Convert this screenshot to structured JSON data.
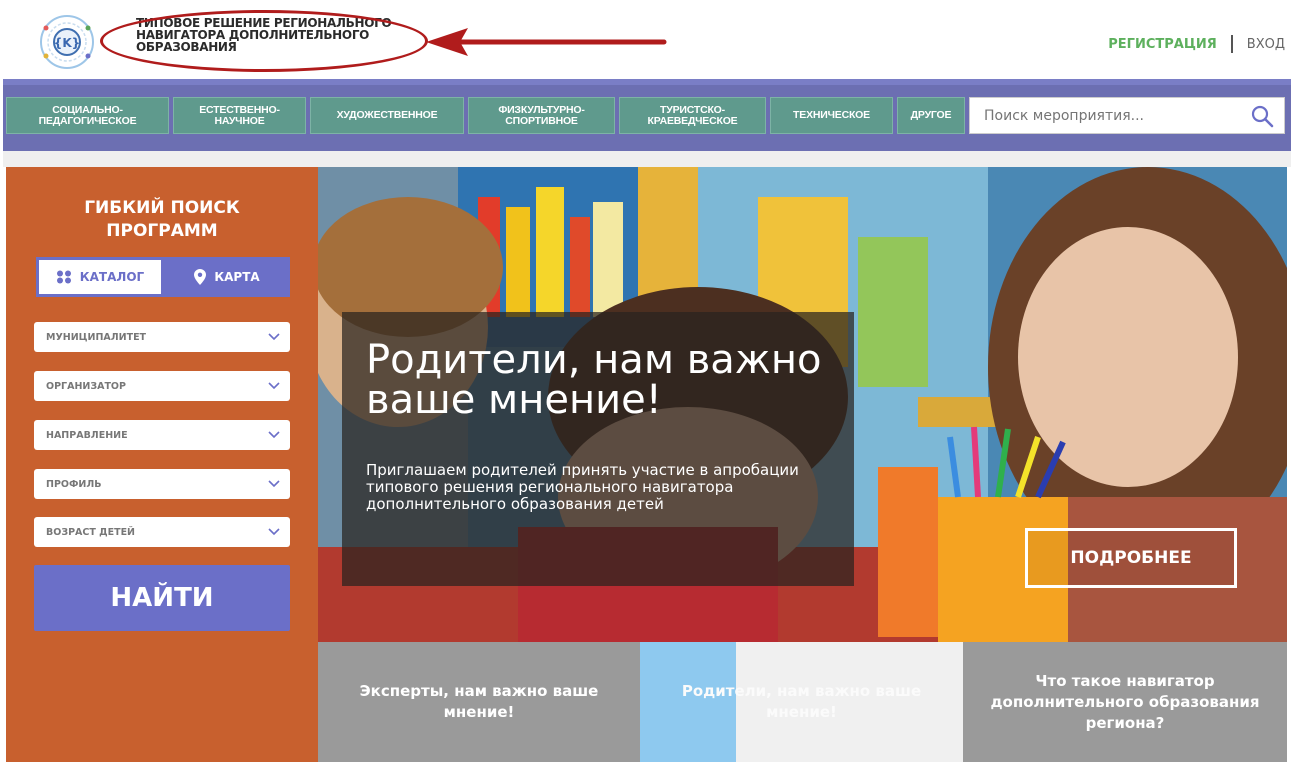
{
  "header": {
    "site_title": "ТИПОВОЕ РЕШЕНИЕ РЕГИОНАЛЬНОГО НАВИГАТОРА ДОПОЛНИТЕЛЬНОГО ОБРАЗОВАНИЯ",
    "register": "РЕГИСТРАЦИЯ",
    "login": "ВХОД"
  },
  "nav": {
    "items": [
      "СОЦИАЛЬНО-\nПЕДАГОГИЧЕСКОЕ",
      "ЕСТЕСТВЕННО-\nНАУЧНОЕ",
      "ХУДОЖЕСТВЕННОЕ",
      "ФИЗКУЛЬТУРНО-\nСПОРТИВНОЕ",
      "ТУРИСТСКО-\nКРАЕВЕДЧЕСКОЕ",
      "ТЕХНИЧЕСКОЕ",
      "ДРУГОЕ"
    ],
    "search_placeholder": "Поиск мероприятия..."
  },
  "sidebar": {
    "title": "ГИБКИЙ ПОИСК ПРОГРАММ",
    "catalog": "КАТАЛОГ",
    "map": "КАРТА",
    "filters": [
      "МУНИЦИПАЛИТЕТ",
      "ОРГАНИЗАТОР",
      "НАПРАВЛЕНИЕ",
      "ПРОФИЛЬ",
      "ВОЗРАСТ ДЕТЕЙ"
    ],
    "find": "НАЙТИ"
  },
  "hero": {
    "title": "Родители, нам важно ваше мнение!",
    "text": "Приглашаем родителей принять участие в апробации типового решения регионального навигатора дополнительного образования детей",
    "more": "ПОДРОБНЕЕ"
  },
  "tiles": [
    "Эксперты, нам важно ваше мнение!",
    "Родители, нам важно ваше мнение!",
    "Что такое навигатор дополнительного образования региона?"
  ],
  "colors": {
    "nav_bg": "#6c6fb2",
    "nav_btn": "#5f9a8d",
    "sidebar": "#c8602e",
    "accent": "#6b6fc8",
    "register": "#5db05d",
    "annotation": "#b01c1c"
  }
}
